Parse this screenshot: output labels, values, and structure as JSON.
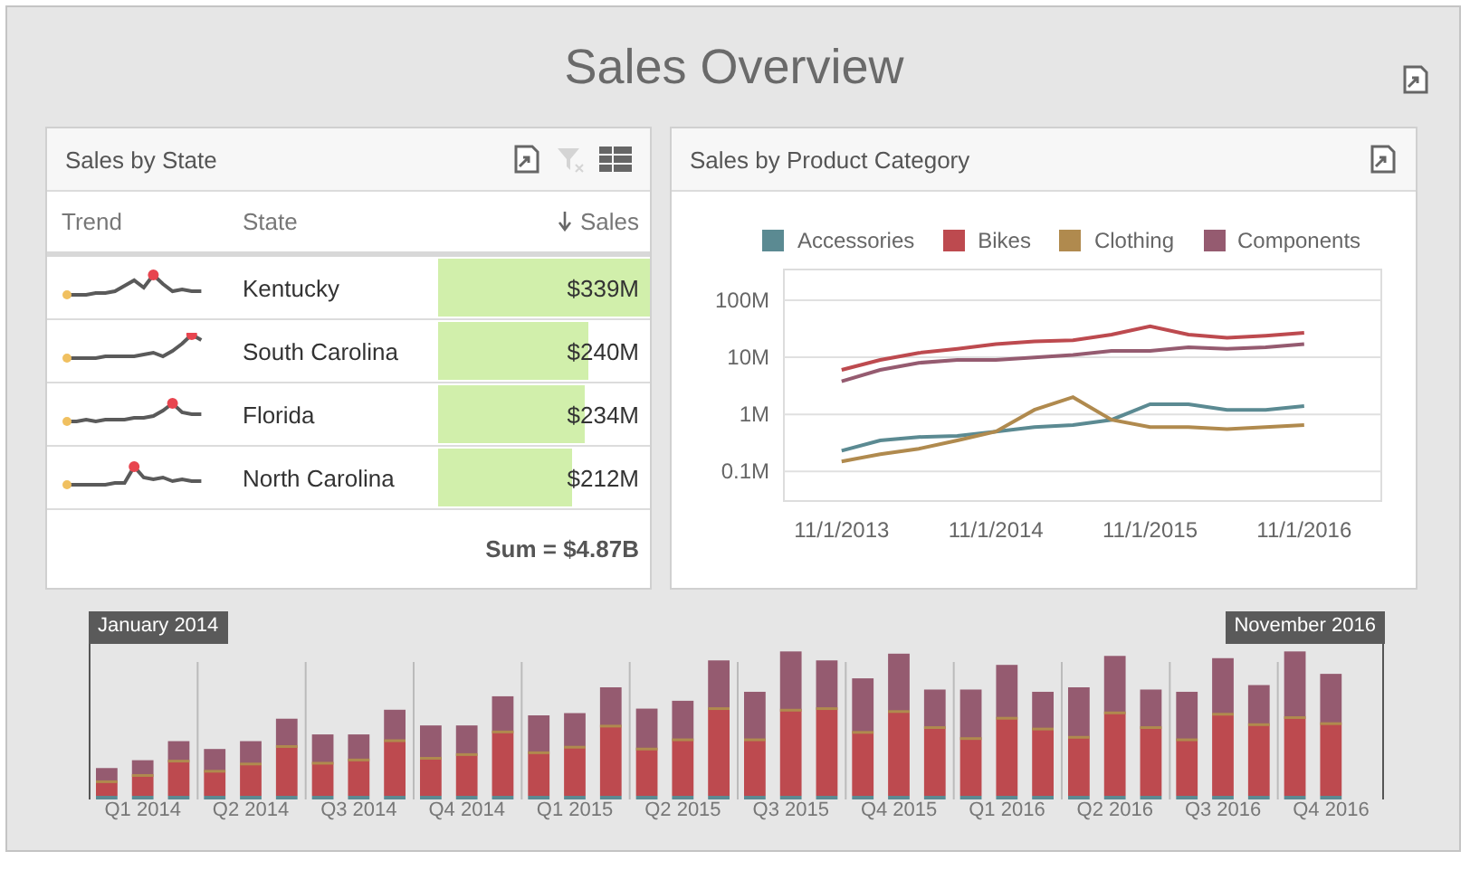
{
  "title": "Sales Overview",
  "state_panel": {
    "title": "Sales by State",
    "filter_clear_disabled": true,
    "columns": [
      {
        "label": "Trend",
        "sorted_descending": false
      },
      {
        "label": "State",
        "sorted_descending": false
      },
      {
        "label": "Sales",
        "sorted_descending": true
      }
    ],
    "rows": [
      {
        "state": "Kentucky",
        "sales": "$339M",
        "level": 1
      },
      {
        "state": "South Carolina",
        "sales": "$240M",
        "level": 0.71
      },
      {
        "state": "Florida",
        "sales": "$234M",
        "level": 0.69
      },
      {
        "state": "North Carolina",
        "sales": "$212M",
        "level": 0.63
      }
    ],
    "total": "Sum = $4.87B"
  },
  "category_panel": {
    "title": "Sales by Product Category",
    "legend": [
      {
        "name": "Accessories",
        "color": "#5b8a92"
      },
      {
        "name": "Bikes",
        "color": "#bd4a4f"
      },
      {
        "name": "Clothing",
        "color": "#b08a4e"
      },
      {
        "name": "Components",
        "color": "#955b70"
      }
    ],
    "y_axis_labels": [
      "100M",
      "10M",
      "1M",
      "0.1M"
    ],
    "x_axis_labels": [
      "11/1/2013",
      "11/1/2014",
      "11/1/2015",
      "11/1/2016"
    ]
  },
  "range": {
    "start_label": "January 2014",
    "end_label": "November 2016",
    "quarters": [
      "Q1 2014",
      "Q2 2014",
      "Q3 2014",
      "Q4 2014",
      "Q1 2015",
      "Q2 2015",
      "Q3 2015",
      "Q4 2015",
      "Q1 2016",
      "Q2 2016",
      "Q3 2016",
      "Q4 2016"
    ]
  }
}
